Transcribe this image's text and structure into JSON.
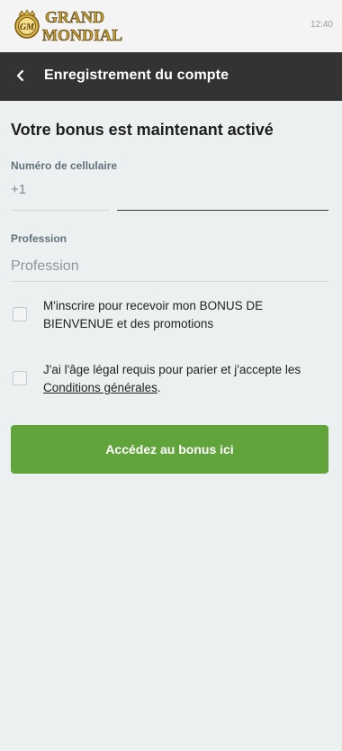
{
  "brand": {
    "logo_line1": "GRAND",
    "logo_line2": "MONDIAL",
    "logo_badge": "GM"
  },
  "status": {
    "time": "12:40"
  },
  "header": {
    "title": "Enregistrement du compte",
    "back_icon": "chevron-left-icon"
  },
  "form": {
    "title": "Votre bonus est maintenant activé",
    "phone": {
      "label": "Numéro de cellulaire",
      "prefix": "+1",
      "value": ""
    },
    "profession": {
      "label": "Profession",
      "placeholder": "Profession",
      "value": ""
    },
    "checkboxes": [
      {
        "text": "M'inscrire pour recevoir mon BONUS DE BIENVENUE et des promotions",
        "checked": false
      },
      {
        "text_before": "J'ai l'âge légal requis pour parier et j'accepte les ",
        "link_text": "Conditions générales",
        "text_after": ".",
        "checked": false
      }
    ],
    "submit_label": "Accédez au bonus ici"
  },
  "colors": {
    "header_bg": "#333333",
    "cta_bg": "#60a43b",
    "page_bg": "#edf0f1",
    "logo_gold": "#b8922a"
  }
}
